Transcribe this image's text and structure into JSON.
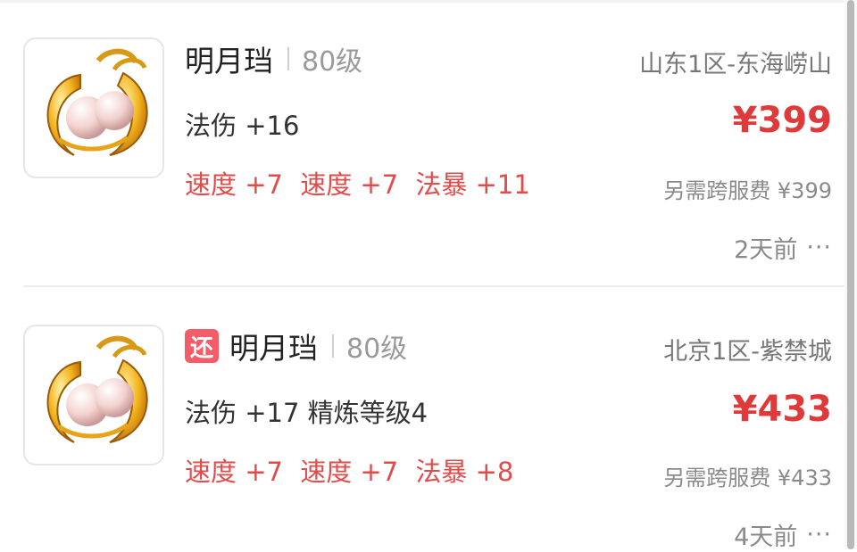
{
  "listings": [
    {
      "name": "明月珰",
      "level": "80级",
      "return_badge": "",
      "base_stat": "法伤 +16",
      "extra_stats": [
        "速度 +7",
        "速度 +7",
        "法暴 +11"
      ],
      "server": "山东1区-东海崂山",
      "price": "¥399",
      "fee": "另需跨服费 ¥399",
      "time": "2天前",
      "more": "···"
    },
    {
      "name": "明月珰",
      "level": "80级",
      "return_badge": "还",
      "base_stat": "法伤 +17 精炼等级4",
      "extra_stats": [
        "速度 +7",
        "速度 +7",
        "法暴 +8"
      ],
      "server": "北京1区-紫禁城",
      "price": "¥433",
      "fee": "另需跨服费 ¥433",
      "time": "4天前",
      "more": "···"
    }
  ],
  "colors": {
    "price": "#e0393a",
    "stat_highlight": "#e34a4a",
    "badge": "#f45c6a"
  },
  "icons": [
    "earring-item-icon",
    "more-icon"
  ]
}
